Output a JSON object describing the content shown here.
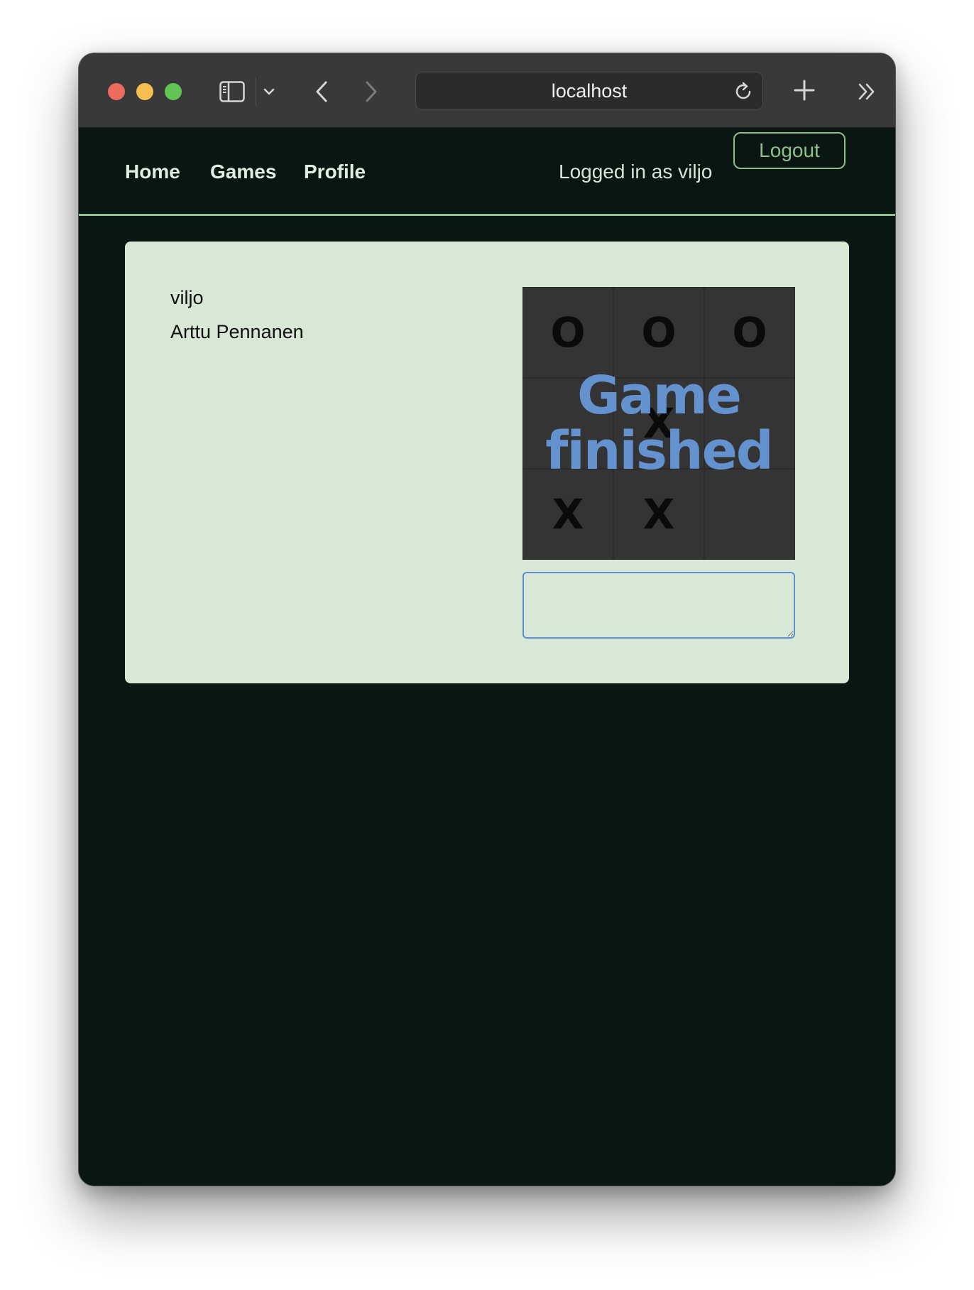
{
  "browser": {
    "address": "localhost",
    "colors": {
      "traffic_close": "#ed6a5e",
      "traffic_minimize": "#f5bf4f",
      "traffic_zoom": "#61c454",
      "chrome_bg": "#393939"
    },
    "icons": [
      "sidebar-icon",
      "chevron-down-icon",
      "back-arrow-icon",
      "forward-arrow-icon",
      "reload-icon",
      "plus-icon",
      "double-chevron-right-icon"
    ]
  },
  "navbar": {
    "links": [
      "Home",
      "Games",
      "Profile"
    ],
    "logged_in_text": "Logged in as viljo",
    "logout_label": "Logout",
    "colors": {
      "background": "#0a1611",
      "accent": "#8cc08c",
      "text": "#e3ece3"
    }
  },
  "game": {
    "players": [
      "viljo",
      "Arttu Pennanen"
    ],
    "board": [
      [
        "O",
        "O",
        "O"
      ],
      [
        "",
        "X",
        ""
      ],
      [
        "X",
        "X",
        ""
      ]
    ],
    "status_line_1": "Game",
    "status_line_2": "finished",
    "message_value": "",
    "colors": {
      "card": "#d9e7d6",
      "board": "#343434",
      "status": "#6392cf",
      "input_border": "#5b8fd1"
    }
  }
}
